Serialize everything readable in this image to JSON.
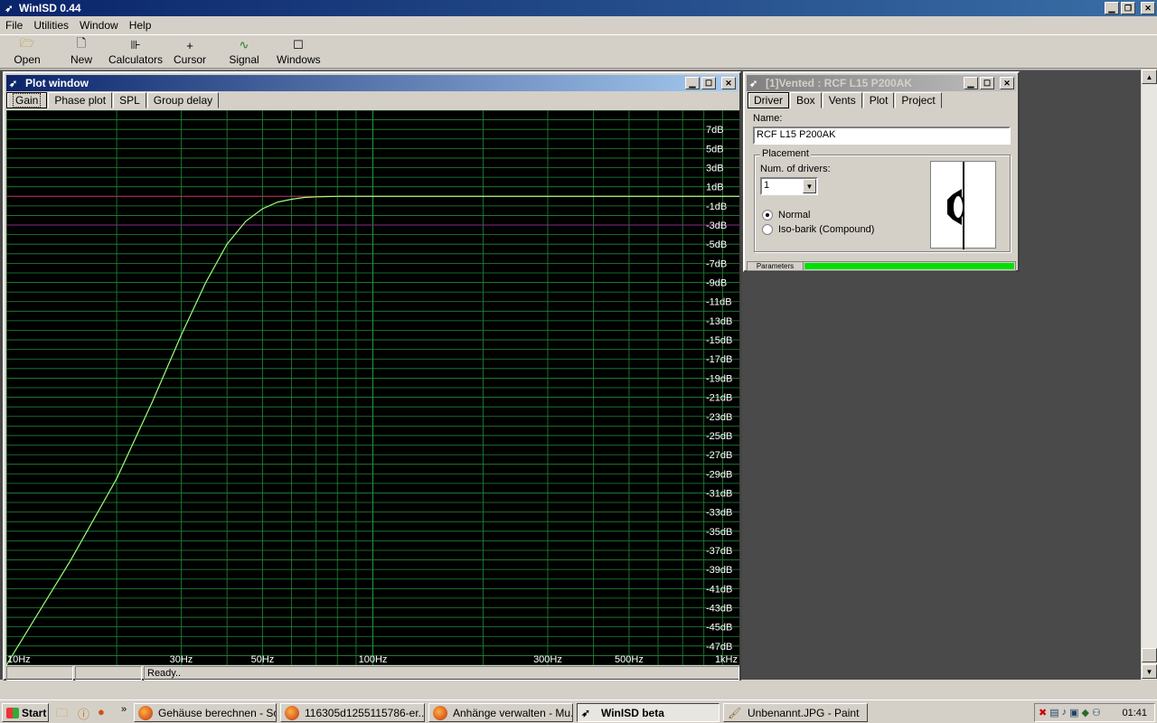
{
  "app": {
    "title": "WinISD 0.44"
  },
  "menu": [
    "File",
    "Utilities",
    "Window",
    "Help"
  ],
  "toolbar": [
    {
      "label": "Open",
      "icon": "folder-open-icon"
    },
    {
      "label": "New",
      "icon": "new-document-icon"
    },
    {
      "label": "Calculators",
      "icon": "calculator-icon"
    },
    {
      "label": "Cursor",
      "icon": "crosshair-icon"
    },
    {
      "label": "Signal gen.",
      "icon": "signal-generator-icon"
    },
    {
      "label": "Windows",
      "icon": "window-icon"
    }
  ],
  "plot_window": {
    "title": "Plot window",
    "tabs": [
      "Gain",
      "Phase plot",
      "SPL",
      "Group delay"
    ],
    "active_tab": "Gain",
    "status": [
      "",
      "",
      "Ready.."
    ]
  },
  "chart_data": {
    "type": "line",
    "xscale": "log",
    "xlim": [
      10,
      1000
    ],
    "ylim": [
      -49,
      9
    ],
    "x_tick_labels": [
      {
        "label": "10Hz",
        "x": 10
      },
      {
        "label": "30Hz",
        "x": 30
      },
      {
        "label": "50Hz",
        "x": 50
      },
      {
        "label": "100Hz",
        "x": 100
      },
      {
        "label": "300Hz",
        "x": 300
      },
      {
        "label": "500Hz",
        "x": 500
      },
      {
        "label": "1kHz",
        "x": 1000
      }
    ],
    "y_tick_labels": [
      "7dB",
      "5dB",
      "3dB",
      "1dB",
      "-1dB",
      "-3dB",
      "-5dB",
      "-7dB",
      "-9dB",
      "-11dB",
      "-13dB",
      "-15dB",
      "-17dB",
      "-19dB",
      "-21dB",
      "-23dB",
      "-25dB",
      "-27dB",
      "-29dB",
      "-31dB",
      "-33dB",
      "-35dB",
      "-37dB",
      "-39dB",
      "-41dB",
      "-43dB",
      "-45dB",
      "-47dB"
    ],
    "y_tick_values": [
      7,
      5,
      3,
      1,
      -1,
      -3,
      -5,
      -7,
      -9,
      -11,
      -13,
      -15,
      -17,
      -19,
      -21,
      -23,
      -25,
      -27,
      -29,
      -31,
      -33,
      -35,
      -37,
      -39,
      -41,
      -43,
      -45,
      -47
    ],
    "reference_lines": [
      {
        "y": 0,
        "color": "#c8285a"
      },
      {
        "y": -3,
        "color": "#8a2a8a"
      }
    ],
    "series": [
      {
        "color": "#9cff7a",
        "x": [
          10,
          15,
          20,
          25,
          30,
          35,
          40,
          45,
          50,
          55,
          60,
          65,
          70,
          75,
          80
        ],
        "y": [
          -49,
          -38,
          -29.5,
          -21.5,
          -14.5,
          -9,
          -5,
          -2.6,
          -1.3,
          -0.6,
          -0.3,
          -0.12,
          -0.05,
          -0.02,
          0
        ]
      }
    ],
    "grid": true,
    "colors": {
      "background": "#000000",
      "grid": "#1f8a36"
    }
  },
  "driver_window": {
    "title": "[1]Vented : RCF L15 P200AK",
    "tabs": [
      "Driver",
      "Box",
      "Vents",
      "Plot",
      "Project"
    ],
    "active_tab": "Driver",
    "name_label": "Name:",
    "name_value": "RCF L15 P200AK",
    "placement_label": "Placement",
    "num_drivers_label": "Num. of drivers:",
    "num_drivers_value": "1",
    "radio_normal": "Normal",
    "radio_isobarik": "Iso-barik (Compound)",
    "selected_radio": "Normal",
    "parameters_label": "Parameters",
    "progress": 1.0
  },
  "taskbar": {
    "start": "Start",
    "items": [
      {
        "label": "Gehäuse berechnen - So...",
        "pressed": false
      },
      {
        "label": "116305d1255115786-er...",
        "pressed": false
      },
      {
        "label": "Anhänge verwalten - Mu...",
        "pressed": false
      },
      {
        "label": "WinISD beta",
        "pressed": true
      },
      {
        "label": "Unbenannt.JPG - Paint",
        "pressed": false
      }
    ],
    "clock": "01:41"
  }
}
